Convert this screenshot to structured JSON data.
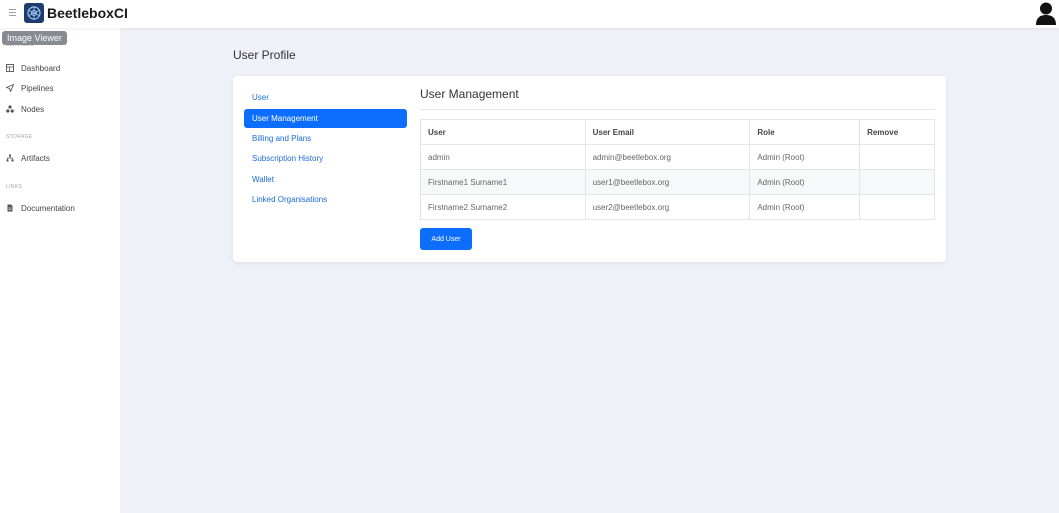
{
  "app": {
    "brand": "BeetleboxCI",
    "tooltip": "Image Viewer"
  },
  "sidebar": {
    "sections": [
      {
        "label": "SERVICES"
      },
      {
        "label": "STORAGE"
      },
      {
        "label": "LINKS"
      }
    ],
    "items": [
      {
        "label": "Dashboard",
        "icon": "dashboard-icon"
      },
      {
        "label": "Pipelines",
        "icon": "pipelines-icon"
      },
      {
        "label": "Nodes",
        "icon": "nodes-icon"
      },
      {
        "label": "Artifacts",
        "icon": "artifacts-icon"
      },
      {
        "label": "Documentation",
        "icon": "document-icon"
      }
    ]
  },
  "page": {
    "title": "User Profile"
  },
  "subnav": {
    "items": [
      {
        "label": "User",
        "active": false
      },
      {
        "label": "User Management",
        "active": true
      },
      {
        "label": "Billing and Plans",
        "active": false
      },
      {
        "label": "Subscription History",
        "active": false
      },
      {
        "label": "Wallet",
        "active": false
      },
      {
        "label": "Linked Organisations",
        "active": false
      }
    ]
  },
  "panel": {
    "title": "User Management",
    "table": {
      "headers": [
        "User",
        "User Email",
        "Role",
        "Remove"
      ],
      "rows": [
        [
          "admin",
          "admin@beetlebox.org",
          "Admin (Root)",
          ""
        ],
        [
          "Firstname1 Surname1",
          "user1@beetlebox.org",
          "Admin (Root)",
          ""
        ],
        [
          "Firstname2 Surname2",
          "user2@beetlebox.org",
          "Admin (Root)",
          ""
        ]
      ]
    },
    "add_user_label": "Add User"
  },
  "colors": {
    "accent": "#0d6efd",
    "link": "#1a6cd8",
    "logo_bg": "#1c3d6e",
    "page_bg": "#eef1f8"
  }
}
